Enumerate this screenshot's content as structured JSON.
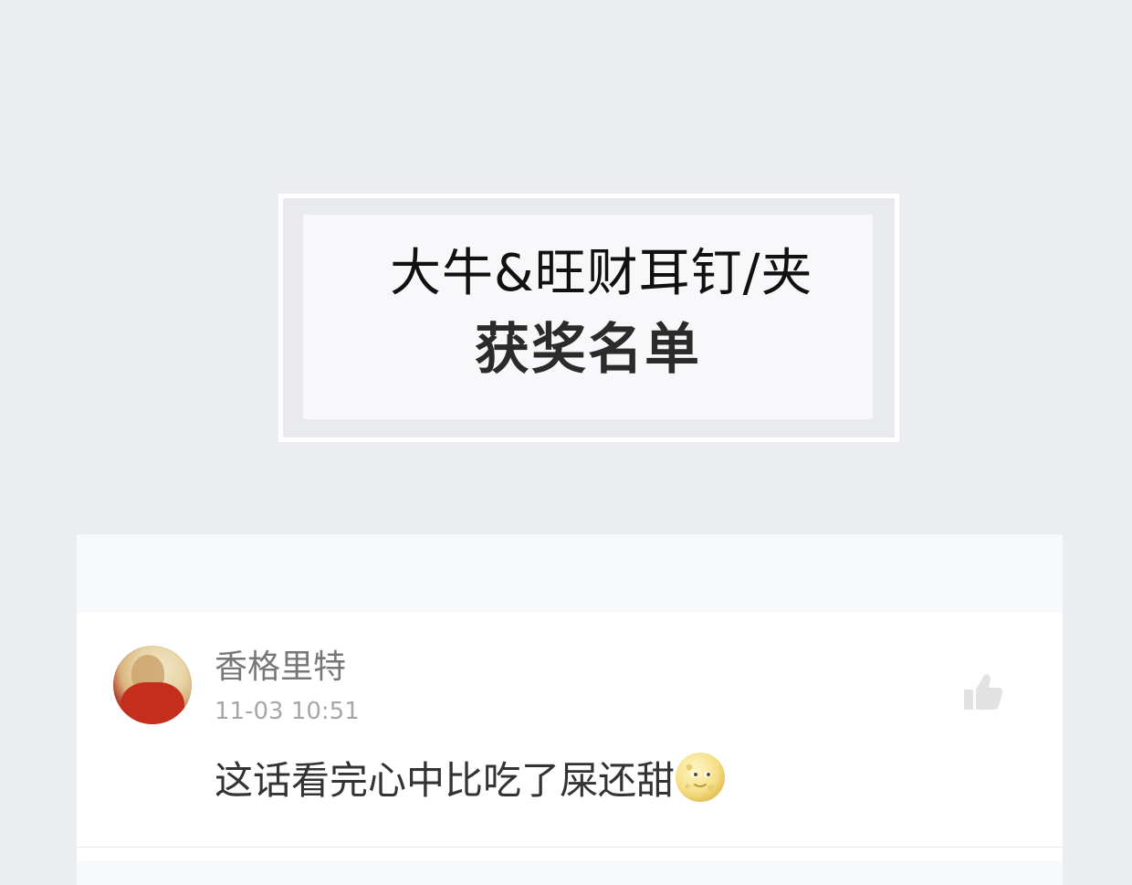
{
  "header": {
    "title_line1": "大牛&旺财耳钉/夹",
    "title_line2": "获奖名单"
  },
  "comment": {
    "username": "香格里特",
    "timestamp": "11-03 10:51",
    "text": "这话看完心中比吃了屎还甜",
    "emoji": "full-moon-face-emoji",
    "like_icon": "thumbs-up-icon"
  },
  "colors": {
    "background": "#ecedf1",
    "card": "#ffffff",
    "username": "#777777",
    "timestamp": "#a7a7a7",
    "text": "#333333",
    "like_icon": "#e2e2e2"
  }
}
